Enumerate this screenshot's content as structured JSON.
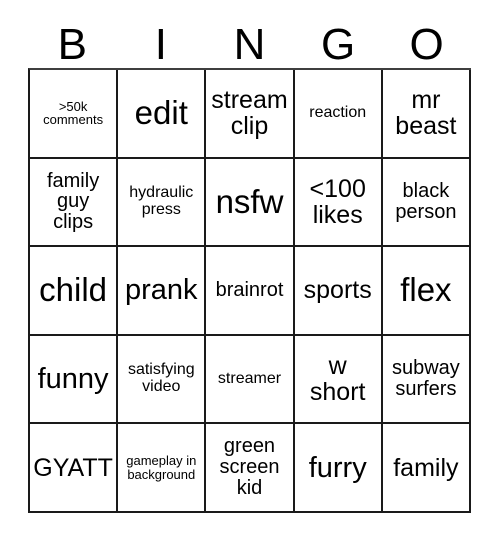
{
  "card": {
    "title": "BINGO",
    "header_letters": [
      "B",
      "I",
      "N",
      "G",
      "O"
    ],
    "grid_size": "5x5",
    "colors": {
      "background": "#ffffff",
      "text": "#000000",
      "border": "#1a1a1a"
    },
    "rows": [
      [
        {
          "text": ">50k\ncomments",
          "size": "xxs"
        },
        {
          "text": "edit",
          "size": "xl"
        },
        {
          "text": "stream\nclip",
          "size": "md"
        },
        {
          "text": "reaction",
          "size": "xs"
        },
        {
          "text": "mr\nbeast",
          "size": "md"
        }
      ],
      [
        {
          "text": "family\nguy\nclips",
          "size": "sm"
        },
        {
          "text": "hydraulic\npress",
          "size": "xs"
        },
        {
          "text": "nsfw",
          "size": "xl"
        },
        {
          "text": "<100\nlikes",
          "size": "md"
        },
        {
          "text": "black\nperson",
          "size": "sm"
        }
      ],
      [
        {
          "text": "child",
          "size": "xl"
        },
        {
          "text": "prank",
          "size": "lg"
        },
        {
          "text": "brainrot",
          "size": "sm"
        },
        {
          "text": "sports",
          "size": "md"
        },
        {
          "text": "flex",
          "size": "xl"
        }
      ],
      [
        {
          "text": "funny",
          "size": "lg"
        },
        {
          "text": "satisfying\nvideo",
          "size": "xs"
        },
        {
          "text": "streamer",
          "size": "xs"
        },
        {
          "text": "w\nshort",
          "size": "md"
        },
        {
          "text": "subway\nsurfers",
          "size": "sm"
        }
      ],
      [
        {
          "text": "GYATT",
          "size": "md"
        },
        {
          "text": "gameplay in\nbackground",
          "size": "xxs"
        },
        {
          "text": "green\nscreen\nkid",
          "size": "sm"
        },
        {
          "text": "furry",
          "size": "lg"
        },
        {
          "text": "family",
          "size": "md"
        }
      ]
    ]
  }
}
